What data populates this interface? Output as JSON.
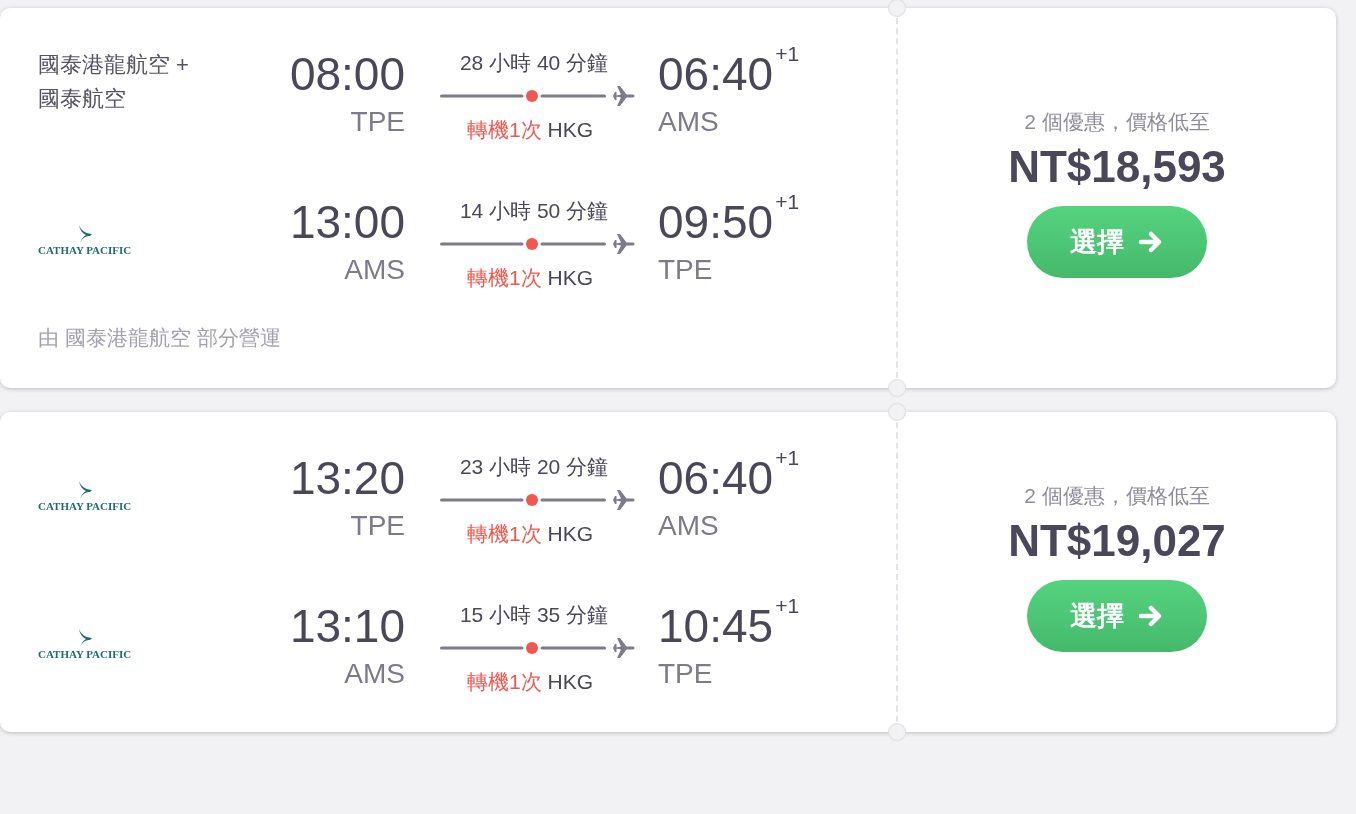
{
  "results": [
    {
      "legs": [
        {
          "airline": {
            "kind": "text",
            "names": [
              "國泰港龍航空 +",
              "國泰航空"
            ]
          },
          "depart_time": "08:00",
          "depart_code": "TPE",
          "duration": "28 小時 40 分鐘",
          "stops": "轉機1次",
          "via": "HKG",
          "arrive_time": "06:40",
          "day_offset": "+1",
          "arrive_code": "AMS"
        },
        {
          "airline": {
            "kind": "logo",
            "wordmark": "CATHAY PACIFIC"
          },
          "depart_time": "13:00",
          "depart_code": "AMS",
          "duration": "14 小時 50 分鐘",
          "stops": "轉機1次",
          "via": "HKG",
          "arrive_time": "09:50",
          "day_offset": "+1",
          "arrive_code": "TPE"
        }
      ],
      "operated_by": "由 國泰港龍航空 部分營運",
      "offers": "2 個優惠，價格低至",
      "price": "NT$18,593",
      "button": "選擇"
    },
    {
      "legs": [
        {
          "airline": {
            "kind": "logo",
            "wordmark": "CATHAY PACIFIC"
          },
          "depart_time": "13:20",
          "depart_code": "TPE",
          "duration": "23 小時 20 分鐘",
          "stops": "轉機1次",
          "via": "HKG",
          "arrive_time": "06:40",
          "day_offset": "+1",
          "arrive_code": "AMS"
        },
        {
          "airline": {
            "kind": "logo",
            "wordmark": "CATHAY PACIFIC"
          },
          "depart_time": "13:10",
          "depart_code": "AMS",
          "duration": "15 小時 35 分鐘",
          "stops": "轉機1次",
          "via": "HKG",
          "arrive_time": "10:45",
          "day_offset": "+1",
          "arrive_code": "TPE"
        }
      ],
      "offers": "2 個優惠，價格低至",
      "price": "NT$19,027",
      "button": "選擇"
    }
  ]
}
